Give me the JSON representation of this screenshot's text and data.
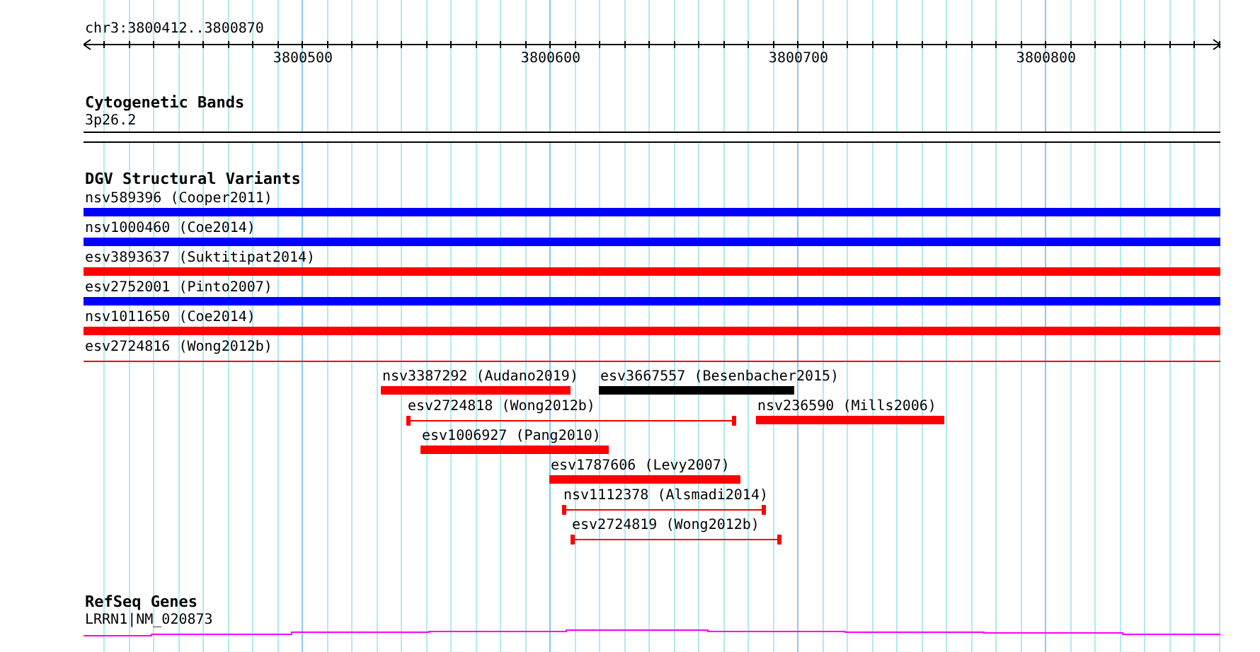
{
  "ruler": {
    "location": "chr3:3800412..3800870",
    "tick_labels": [
      "3800500",
      "3800600",
      "3800700",
      "3800800"
    ]
  },
  "cytogenetic_bands": {
    "title": "Cytogenetic Bands",
    "band_label": "3p26.2"
  },
  "dgv": {
    "title": "DGV Structural Variants",
    "variants": [
      {
        "label": "nsv589396 (Cooper2011)",
        "kind": "bar",
        "color": "#0000ff"
      },
      {
        "label": "nsv1000460 (Coe2014)",
        "kind": "bar",
        "color": "#0000ff"
      },
      {
        "label": "esv3893637 (Suktitipat2014)",
        "kind": "bar",
        "color": "#ff0000"
      },
      {
        "label": "esv2752001 (Pinto2007)",
        "kind": "bar",
        "color": "#0000ff"
      },
      {
        "label": "nsv1011650 (Coe2014)",
        "kind": "bar",
        "color": "#ff0000"
      },
      {
        "label": "esv2724816 (Wong2012b)",
        "kind": "line",
        "color": "#ff0000"
      },
      {
        "label": "nsv3387292 (Audano2019)",
        "kind": "bar",
        "color": "#ff0000"
      },
      {
        "label": "esv3667557 (Besenbacher2015)",
        "kind": "bar",
        "color": "#000000"
      },
      {
        "label": "esv2724818 (Wong2012b)",
        "kind": "line",
        "color": "#ff0000"
      },
      {
        "label": "nsv236590 (Mills2006)",
        "kind": "bar",
        "color": "#ff0000"
      },
      {
        "label": "esv1006927 (Pang2010)",
        "kind": "bar",
        "color": "#ff0000"
      },
      {
        "label": "esv1787606 (Levy2007)",
        "kind": "bar",
        "color": "#ff0000"
      },
      {
        "label": "nsv1112378 (Alsmadi2014)",
        "kind": "line",
        "color": "#ff0000"
      },
      {
        "label": "esv2724819 (Wong2012b)",
        "kind": "line",
        "color": "#ff0000"
      }
    ]
  },
  "refseq": {
    "title": "RefSeq Genes",
    "gene_label": "LRRN1|NM_020873"
  }
}
